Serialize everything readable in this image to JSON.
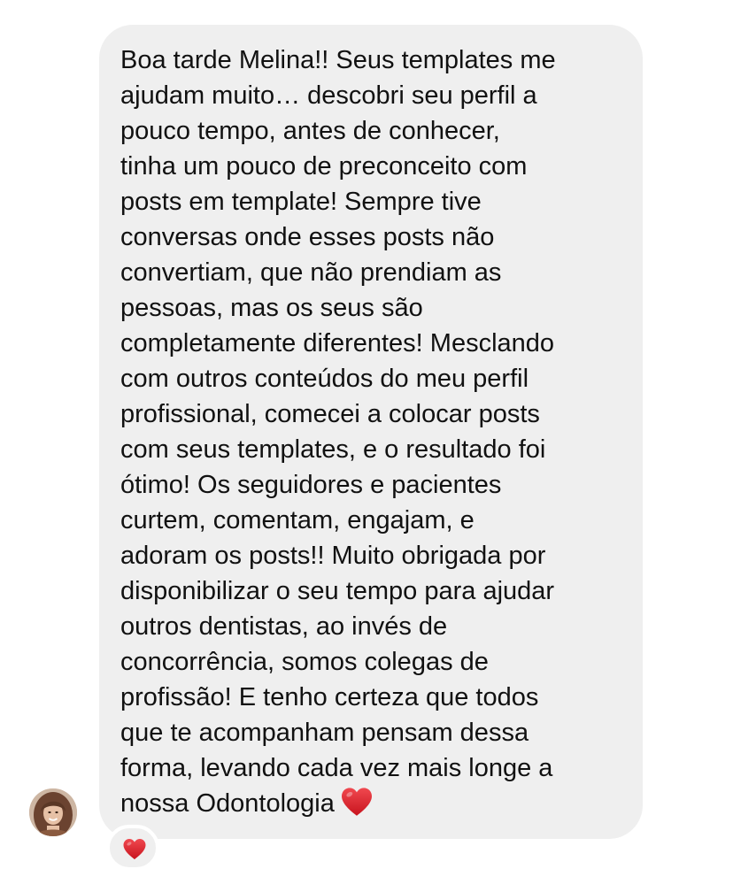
{
  "message": {
    "lines": [
      "Boa tarde Melina!! Seus templates me",
      "ajudam muito… descobri seu perfil a",
      "pouco tempo, antes de conhecer,",
      "tinha um pouco de preconceito com",
      "posts em template! Sempre tive",
      "conversas onde esses posts não",
      "convertiam, que não prendiam as",
      "pessoas, mas os seus são",
      "completamente diferentes! Mesclando",
      "com outros conteúdos do meu perfil",
      "profissional, comecei a colocar posts",
      "com seus templates, e o resultado foi",
      "ótimo! Os seguidores e pacientes",
      "curtem, comentam, engajam, e",
      "adoram os posts!! Muito obrigada por",
      "disponibilizar o seu tempo para ajudar",
      "outros dentistas, ao invés de",
      "concorrência, somos colegas de",
      "profissão! E tenho certeza que todos",
      "que te acompanham pensam dessa",
      "forma, levando cada vez mais longe a",
      "nossa Odontologia"
    ],
    "trailing_emoji": "heart-emoji"
  },
  "reaction": {
    "emoji": "heart-emoji"
  },
  "colors": {
    "bubble": "#efefef",
    "text": "#111111",
    "heart": "#e0262f",
    "background": "#ffffff"
  }
}
